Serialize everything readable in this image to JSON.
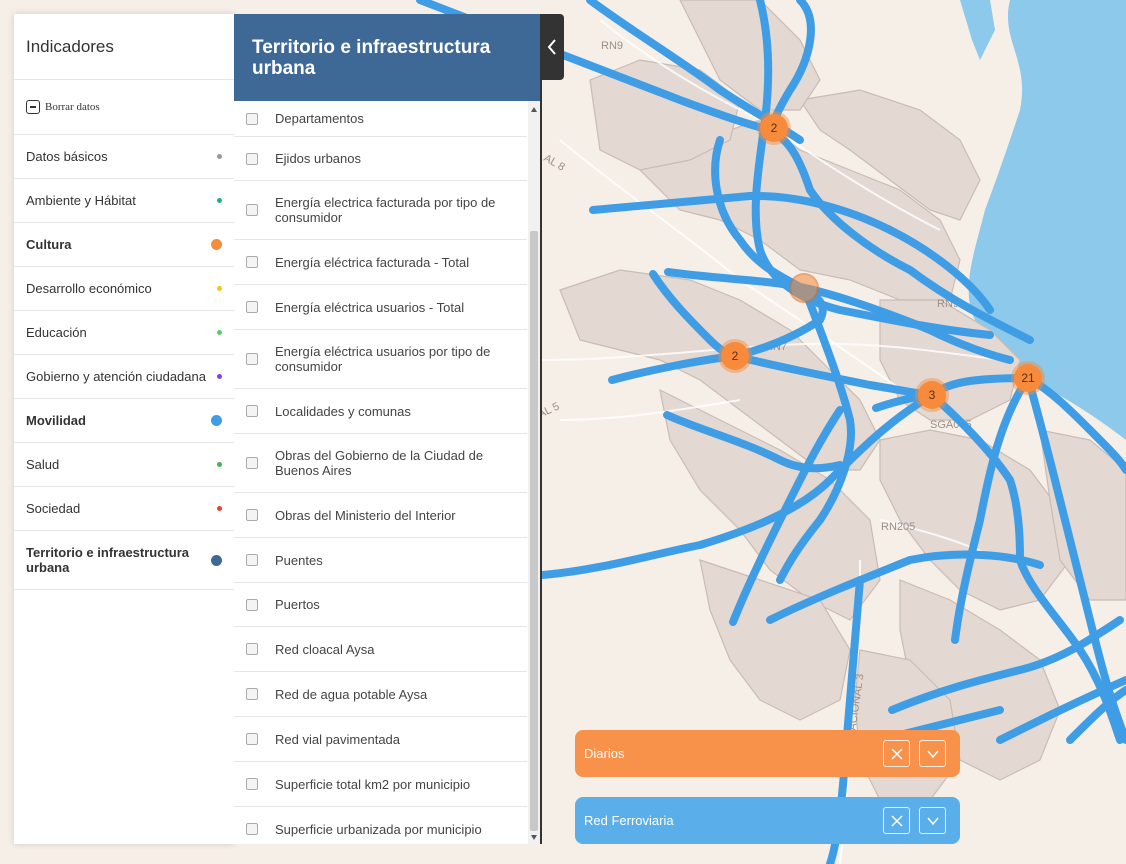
{
  "sidebar": {
    "title": "Indicadores",
    "clear_label": "Borrar datos",
    "categories": [
      {
        "label": "Datos básicos",
        "color": "#999999"
      },
      {
        "label": "Ambiente y Hábitat",
        "color": "#22b07d"
      },
      {
        "label": "Cultura",
        "color": "#f78b3b"
      },
      {
        "label": "Desarrollo económico",
        "color": "#f5c518"
      },
      {
        "label": "Educación",
        "color": "#5ec96e"
      },
      {
        "label": "Gobierno y atención ciudadana",
        "color": "#8a3ee6"
      },
      {
        "label": "Movilidad",
        "color": "#3f9de6"
      },
      {
        "label": "Salud",
        "color": "#4caf50"
      },
      {
        "label": "Sociedad",
        "color": "#e0453b"
      },
      {
        "label": "Territorio e infraestructura urbana",
        "color": "#3e6896"
      }
    ]
  },
  "panel": {
    "title": "Territorio e infraestructura urbana",
    "header_color": "#3e6896",
    "items": [
      "Departamentos",
      "Ejidos urbanos",
      "Energía electrica facturada por tipo de consumidor",
      "Energía eléctrica facturada - Total",
      "Energía eléctrica usuarios - Total",
      "Energía eléctrica usuarios por tipo de consumidor",
      "Localidades y comunas",
      "Obras del Gobierno de la Ciudad de Buenos Aires",
      "Obras del Ministerio del Interior",
      "Puentes",
      "Puertos",
      "Red cloacal Aysa",
      "Red de agua potable Aysa",
      "Red vial pavimentada",
      "Superficie total km2 por municipio",
      "Superficie urbanizada por municipio"
    ]
  },
  "map": {
    "road_labels": [
      "RN9",
      "RN9",
      "RN7",
      "RN205",
      "AL 8",
      "AL 5",
      "RUTA NACIONAL 3",
      "SGA005"
    ],
    "clusters": [
      "2",
      "2",
      "3",
      "21",
      ""
    ],
    "icons": {
      "collapse": "chevron-left-icon",
      "close": "close-icon",
      "expand": "chevron-down-icon"
    }
  },
  "layers": [
    {
      "name": "Diarios",
      "color": "#f8924a"
    },
    {
      "name": "Red Ferroviaria",
      "color": "#5aaeea"
    }
  ]
}
